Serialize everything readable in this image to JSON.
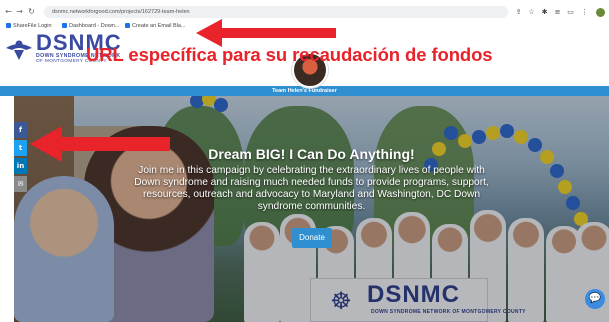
{
  "browser": {
    "url": "dsnmc.networkforgood.com/projects/162729-team-helen",
    "bookmarks": [
      "ShareFile Login",
      "Dashboard - Down...",
      "Create an Email Bla..."
    ]
  },
  "site": {
    "logo_text": "DSNMC",
    "logo_sub": "DOWN SYNDROME NETWORK",
    "logo_sub2": "OF MONTGOMERY COUNTY",
    "team_title": "Team Helen's Fundraiser"
  },
  "annotation": {
    "text": "URL específica para su recaudación de fondos",
    "color": "#e8232a"
  },
  "hero": {
    "title": "Dream BIG! I Can Do Anything!",
    "body": "Join me in this campaign by celebrating the extraordinary lives of people with Down syndrome and raising much needed funds to provide programs, support, resources, outreach and advocacy to Maryland and Washington, DC Down syndrome communities.",
    "donate_label": "Donate",
    "banner_text": "DSNMC",
    "banner_sub": "DOWN SYNDROME NETWORK OF MONTGOMERY COUNTY"
  },
  "social": [
    {
      "icon": "facebook-icon",
      "glyph": "f",
      "color": "#3b5998"
    },
    {
      "icon": "twitter-icon",
      "glyph": "t",
      "color": "#1da1f2"
    },
    {
      "icon": "linkedin-icon",
      "glyph": "in",
      "color": "#0077b5"
    },
    {
      "icon": "email-icon",
      "glyph": "✉",
      "color": "#8a8a8a"
    }
  ],
  "colors": {
    "brand_blue": "#2f8fd0",
    "logo_navy": "#3a4aa0"
  }
}
